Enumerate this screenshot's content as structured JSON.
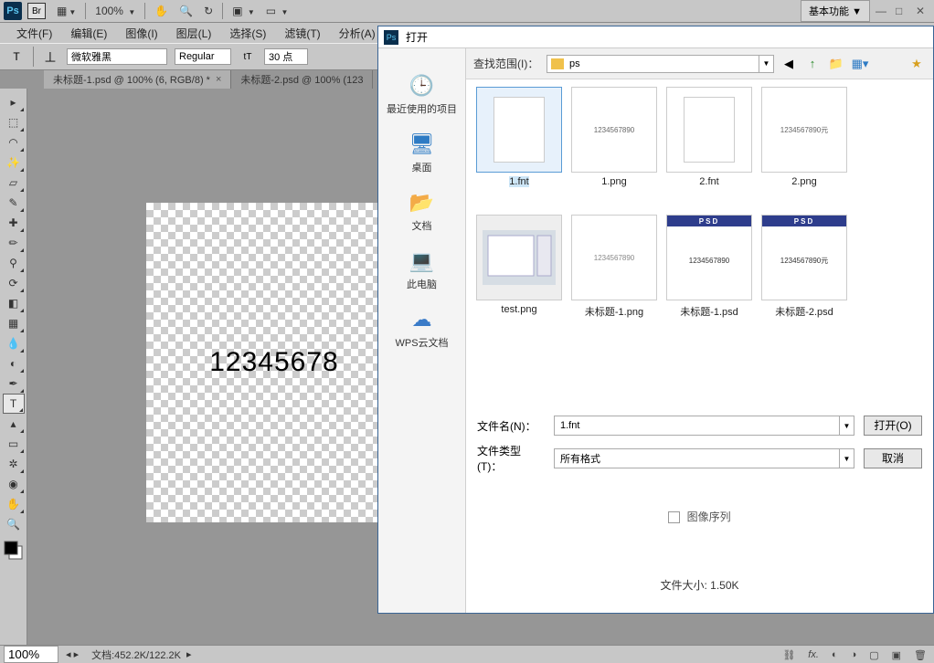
{
  "app": {
    "zoom": "100%",
    "workspace": "基本功能",
    "ps": "Ps",
    "br": "Br"
  },
  "menu": {
    "file": "文件(F)",
    "edit": "编辑(E)",
    "image": "图像(I)",
    "layer": "图层(L)",
    "select": "选择(S)",
    "filter": "滤镜(T)",
    "analyze": "分析(A)"
  },
  "opt": {
    "font": "微软雅黑",
    "weight": "Regular",
    "size": "30 点"
  },
  "tabs": [
    {
      "label": "未标题-1.psd @ 100% (6, RGB/8) *",
      "active": true
    },
    {
      "label": "未标题-2.psd @ 100% (123",
      "active": false
    }
  ],
  "canvas": {
    "text": "12345678"
  },
  "status": {
    "zoom": "100%",
    "doc": "文档:452.2K/122.2K"
  },
  "dialog": {
    "title": "打开",
    "searchLabel": "查找范围(I)：",
    "folder": "ps",
    "places": [
      {
        "label": "最近使用的项目"
      },
      {
        "label": "桌面"
      },
      {
        "label": "文档"
      },
      {
        "label": "此电脑"
      },
      {
        "label": "WPS云文档"
      }
    ],
    "files": [
      {
        "name": "1.fnt",
        "selected": true,
        "kind": "page"
      },
      {
        "name": "1.png",
        "kind": "img",
        "content": "1234567890"
      },
      {
        "name": "2.fnt",
        "kind": "page"
      },
      {
        "name": "2.png",
        "kind": "img",
        "content": "1234567890元"
      },
      {
        "name": "test.png",
        "kind": "app"
      },
      {
        "name": "未标题-1.png",
        "kind": "img",
        "content": "1234567890"
      },
      {
        "name": "未标题-1.psd",
        "kind": "psd",
        "content": "1234567890"
      },
      {
        "name": "未标题-2.psd",
        "kind": "psd",
        "content": "1234567890元"
      }
    ],
    "filenameLabel": "文件名(N)：",
    "filename": "1.fnt",
    "filetypeLabel": "文件类型(T)：",
    "filetype": "所有格式",
    "open": "打开(O)",
    "cancel": "取消",
    "imageSeq": "图像序列",
    "filesize": "文件大小: 1.50K"
  }
}
